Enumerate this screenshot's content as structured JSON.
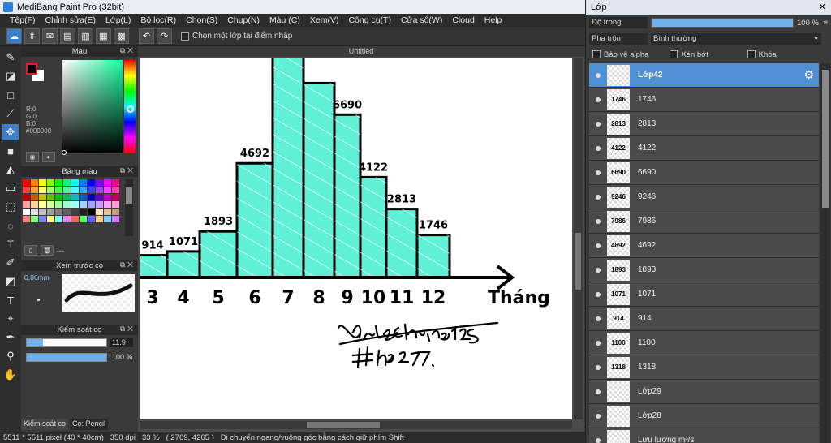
{
  "window": {
    "title": "MediBang Paint Pro (32bit)"
  },
  "menu": [
    "Tệp(F)",
    "Chỉnh sửa(E)",
    "Lớp(L)",
    "Bộ lọc(R)",
    "Chọn(S)",
    "Chụp(N)",
    "Màu (C)",
    "Xem(V)",
    "Công cụ(T)",
    "Cửa sổ(W)",
    "Cloud",
    "Help"
  ],
  "toolbar": {
    "select_layer_label": "Chọn một lớp tại điểm nhấp"
  },
  "panels": {
    "color": {
      "title": "Màu",
      "r": "R:0",
      "g": "G:0",
      "b": "B:0",
      "hex": "#000000"
    },
    "palette": {
      "title": "Bảng màu",
      "name": "---",
      "colors": [
        "#ff0000",
        "#ff8000",
        "#ffff00",
        "#80ff00",
        "#00ff00",
        "#00ff80",
        "#00ffff",
        "#0080ff",
        "#0000ff",
        "#8000ff",
        "#ff00ff",
        "#ff0080",
        "#ff4040",
        "#ffa040",
        "#ffff60",
        "#a0ff60",
        "#40ff40",
        "#40ffa0",
        "#40ffff",
        "#40a0ff",
        "#4040ff",
        "#a040ff",
        "#ff40ff",
        "#ff40a0",
        "#c00000",
        "#c06000",
        "#c0c000",
        "#60c000",
        "#00c000",
        "#00c060",
        "#00c0c0",
        "#0060c0",
        "#0000c0",
        "#6000c0",
        "#c000c0",
        "#c00060",
        "#ffa0a0",
        "#ffd0a0",
        "#ffffa0",
        "#d0ffa0",
        "#a0ffa0",
        "#a0ffd0",
        "#a0ffff",
        "#a0d0ff",
        "#a0a0ff",
        "#d0a0ff",
        "#ffa0ff",
        "#ffa0d0",
        "#ffffff",
        "#e0e0e0",
        "#c0c0c0",
        "#a0a0a0",
        "#808080",
        "#606060",
        "#404040",
        "#202020",
        "#000000",
        "#ffe0c0",
        "#e0c0a0",
        "#c0a080",
        "#ff8080",
        "#80ff80",
        "#8080ff",
        "#ffff80",
        "#80ffff",
        "#ff80ff",
        "#ff6060",
        "#60ff60",
        "#6060ff",
        "#ffd080",
        "#80d0ff",
        "#d080ff"
      ]
    },
    "preview": {
      "title": "Xem trước cọ",
      "size": "0.86mm"
    },
    "control": {
      "title": "Kiểm soát cọ",
      "size_value": "11.9",
      "size_fraction": 0.2,
      "opacity_value": "100 %",
      "opacity_fraction": 1.0
    },
    "bottom_tabs": [
      "Kiểm soát cọ",
      "Cọ: Pencil"
    ]
  },
  "document": {
    "tab": "Untitled"
  },
  "status": {
    "size": "5511 * 5511 pixel",
    "cm": "(40 * 40cm)",
    "dpi": "350 dpi",
    "zoom": "33 %",
    "coords": "( 2769, 4265 )",
    "hint": "Di chuyển ngang/vuông góc bằng cách giữ phím Shift"
  },
  "drawing": {
    "x_labels": [
      "3",
      "4",
      "5",
      "6",
      "7",
      "8",
      "9",
      "10",
      "11",
      "12"
    ],
    "values": [
      914,
      1071,
      1893,
      4692,
      9246,
      7986,
      6690,
      4122,
      2813,
      1746
    ],
    "value_labels": [
      "914",
      "1071",
      "1893",
      "4692",
      "6690",
      "4122",
      "2813",
      "1746"
    ],
    "axis_title": "Tháng",
    "bar_color": "#5ff0d6",
    "signature": "DLulChains125 #hd247."
  },
  "layers": {
    "title": "Lớp",
    "opacity_label": "Độ trong",
    "opacity_value": "100 %",
    "blend_label": "Pha trộn",
    "blend_value": "Bình thường",
    "protect_alpha": "Bảo vệ alpha",
    "clipping": "Xén bớt",
    "lock": "Khóa",
    "items": [
      {
        "name": "Lớp42",
        "thumb": "",
        "selected": true
      },
      {
        "name": "1746",
        "thumb": "1746"
      },
      {
        "name": "2813",
        "thumb": "2813"
      },
      {
        "name": "4122",
        "thumb": "4122"
      },
      {
        "name": "6690",
        "thumb": "6690"
      },
      {
        "name": "9246",
        "thumb": "9246"
      },
      {
        "name": "7986",
        "thumb": "7986"
      },
      {
        "name": "4692",
        "thumb": "4692"
      },
      {
        "name": "1893",
        "thumb": "1893"
      },
      {
        "name": "1071",
        "thumb": "1071"
      },
      {
        "name": "914",
        "thumb": "914"
      },
      {
        "name": "1100",
        "thumb": "1100"
      },
      {
        "name": "1318",
        "thumb": "1318"
      },
      {
        "name": "Lớp29",
        "thumb": ""
      },
      {
        "name": "Lớp28",
        "thumb": ""
      },
      {
        "name": "Lưu lượng m³/s",
        "thumb": ""
      }
    ]
  }
}
